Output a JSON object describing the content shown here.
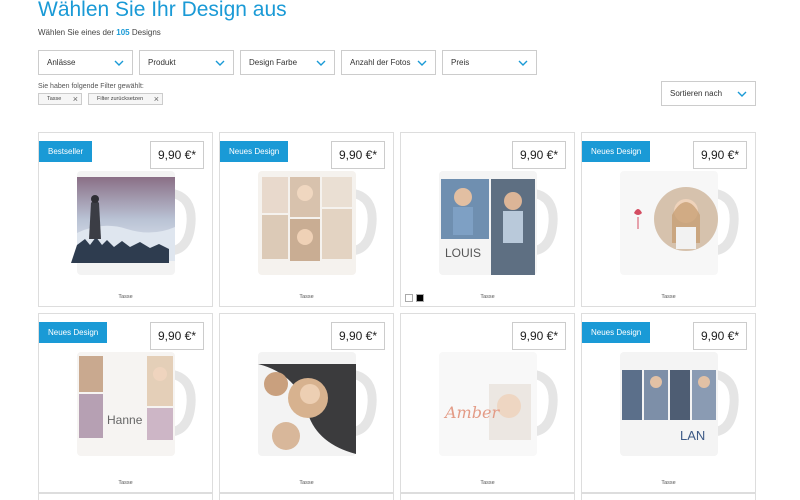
{
  "header": {
    "title": "Wählen Sie Ihr Design aus",
    "subtitle_prefix": "Wählen Sie eines der",
    "count": "105",
    "subtitle_suffix": "Designs"
  },
  "filters": [
    {
      "label": "Anlässe"
    },
    {
      "label": "Produkt"
    },
    {
      "label": "Design Farbe"
    },
    {
      "label": "Anzahl der Fotos"
    },
    {
      "label": "Preis"
    }
  ],
  "active_filters": {
    "heading": "Sie haben folgende Filter gewählt:",
    "chips": [
      {
        "label": "Tasse"
      },
      {
        "label": "Filter zurücksetzen"
      }
    ]
  },
  "sort": {
    "label": "Sortieren nach"
  },
  "colors": {
    "accent": "#1a9ad6"
  },
  "products": [
    {
      "badge": "Bestseller",
      "price": "9,90 €*",
      "label": "Tasse"
    },
    {
      "badge": "Neues Design",
      "price": "9,90 €*",
      "label": "Tasse"
    },
    {
      "badge": "",
      "price": "9,90 €*",
      "label": "Tasse",
      "mug_text": "LOUIS"
    },
    {
      "badge": "Neues Design",
      "price": "9,90 €*",
      "label": "Tasse"
    },
    {
      "badge": "Neues Design",
      "price": "9,90 €*",
      "label": "Tasse",
      "mug_text": "Hanne"
    },
    {
      "badge": "",
      "price": "9,90 €*",
      "label": "Tasse"
    },
    {
      "badge": "",
      "price": "9,90 €*",
      "label": "Tasse",
      "mug_text": "Amber"
    },
    {
      "badge": "Neues Design",
      "price": "9,90 €*",
      "label": "Tasse",
      "mug_text": "LAN"
    }
  ]
}
